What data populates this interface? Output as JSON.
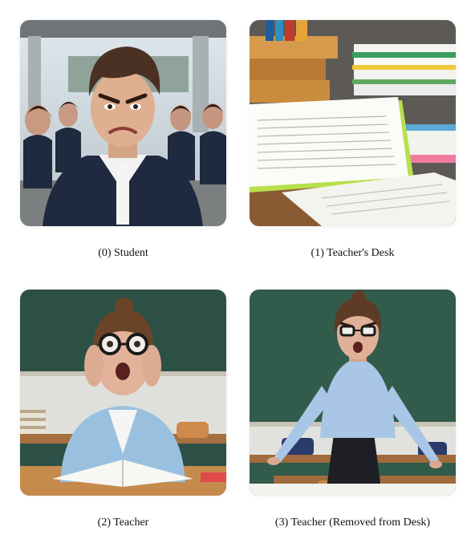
{
  "panels": [
    {
      "caption": "(0) Student",
      "subject": "angry student with classmates"
    },
    {
      "caption": "(1) Teacher's Desk",
      "subject": "desk stacked with books and papers"
    },
    {
      "caption": "(2) Teacher",
      "subject": "shocked teacher at desk with open book"
    },
    {
      "caption": "(3) Teacher (Removed from Desk)",
      "subject": "furious teacher standing and leaning on desk"
    }
  ]
}
